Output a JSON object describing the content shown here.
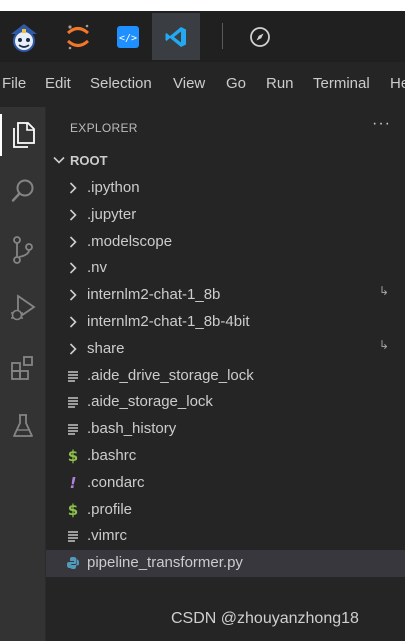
{
  "menubar": {
    "items": [
      "File",
      "Edit",
      "Selection",
      "View",
      "Go",
      "Run",
      "Terminal",
      "He"
    ]
  },
  "explorer": {
    "title": "EXPLORER",
    "more_label": "···",
    "root_label": "ROOT",
    "items": [
      {
        "name": ".ipython",
        "kind": "folder"
      },
      {
        "name": ".jupyter",
        "kind": "folder"
      },
      {
        "name": ".modelscope",
        "kind": "folder"
      },
      {
        "name": ".nv",
        "kind": "folder"
      },
      {
        "name": "internlm2-chat-1_8b",
        "kind": "folder",
        "symlink": true
      },
      {
        "name": "internlm2-chat-1_8b-4bit",
        "kind": "folder"
      },
      {
        "name": "share",
        "kind": "folder",
        "symlink": true
      },
      {
        "name": ".aide_drive_storage_lock",
        "kind": "text-file"
      },
      {
        "name": ".aide_storage_lock",
        "kind": "text-file"
      },
      {
        "name": ".bash_history",
        "kind": "text-file"
      },
      {
        "name": ".bashrc",
        "kind": "shell-file"
      },
      {
        "name": ".condarc",
        "kind": "config-file"
      },
      {
        "name": ".profile",
        "kind": "shell-file"
      },
      {
        "name": ".vimrc",
        "kind": "text-file"
      },
      {
        "name": "pipeline_transformer.py",
        "kind": "python-file",
        "selected": true
      }
    ]
  },
  "symlink_glyph": "↳",
  "watermark": "CSDN @zhouyanzhong18",
  "colors": {
    "editor_bg": "#252526",
    "activity_bg": "#333333",
    "selected_row": "#37373d",
    "shell_green": "#8dc149",
    "condarc_purple": "#b180d7",
    "python_blue": "#519aba",
    "vscode_blue": "#23a9f2"
  }
}
